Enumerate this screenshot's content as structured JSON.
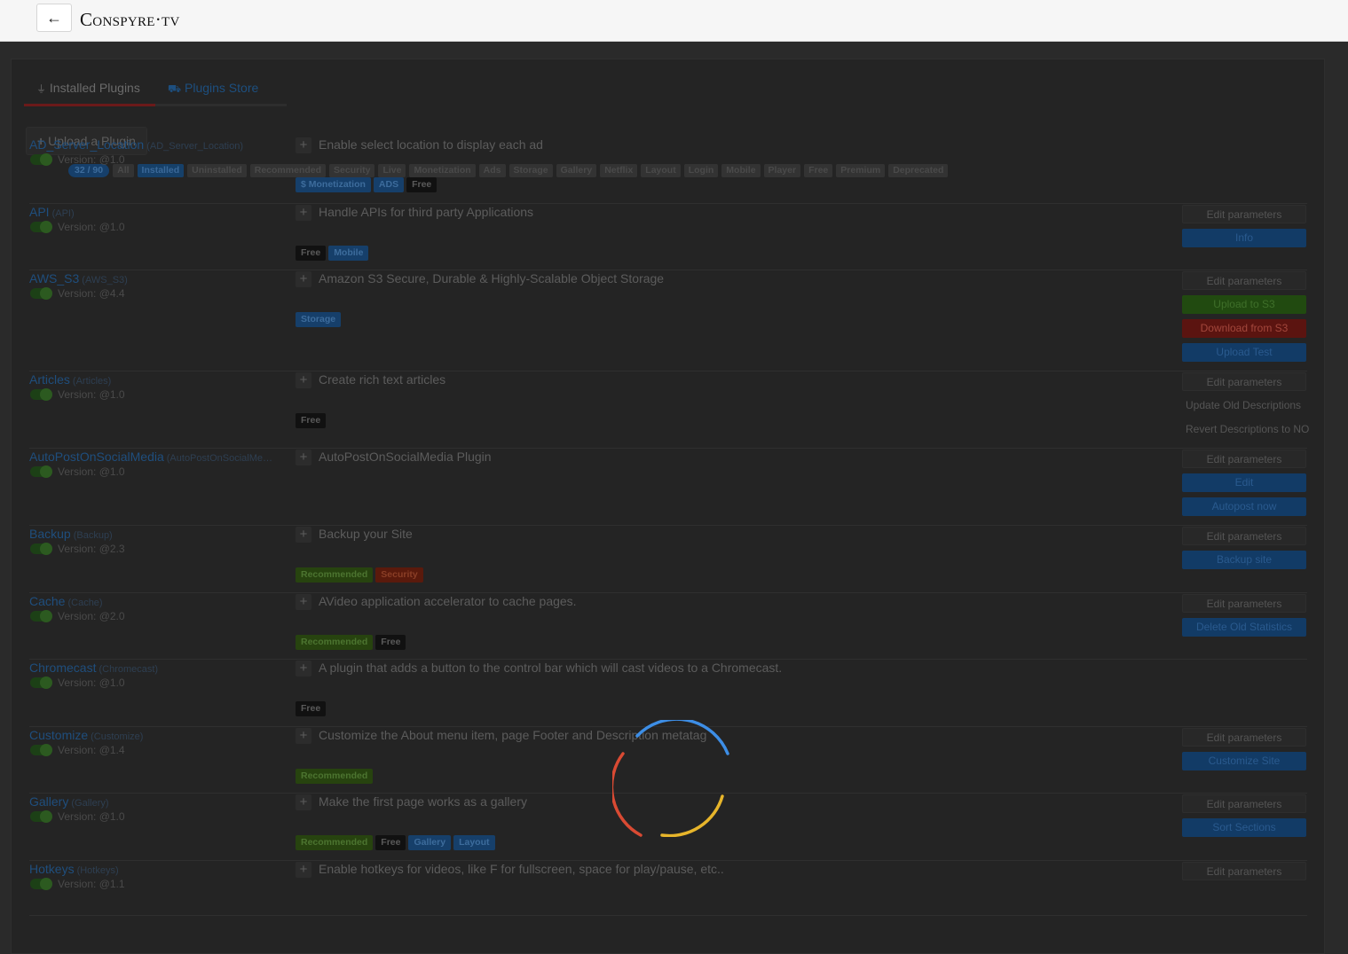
{
  "header": {
    "back_icon": "←",
    "logo": "Conspyre·tv"
  },
  "tabs": [
    {
      "icon": "plug-icon",
      "label": "Installed Plugins",
      "icon_glyph": "🔌"
    },
    {
      "icon": "cart-icon",
      "label": "Plugins Store",
      "icon_glyph": "🛒"
    }
  ],
  "upload_button": {
    "label": "Upload a Plugin",
    "icon_glyph": "+"
  },
  "filters": [
    "32 / 90",
    "All",
    "Installed",
    "Uninstalled",
    "Recommended",
    "Security",
    "Live",
    "Monetization",
    "Ads",
    "Storage",
    "Gallery",
    "Netflix",
    "Layout",
    "Login",
    "Mobile",
    "Player",
    "Free",
    "Premium",
    "Deprecated"
  ],
  "plugins": [
    {
      "name": "AD_Server_Location",
      "uuid": "(AD_Server_Location)",
      "version": "Version: @1.0",
      "description": "Enable select location to display each ad",
      "tags": [
        {
          "label": "$ Monetization",
          "color": "blue"
        },
        {
          "label": "ADS",
          "color": "blue"
        },
        {
          "label": "Free",
          "color": "dark"
        }
      ],
      "actions": []
    },
    {
      "name": "API",
      "uuid": "(API)",
      "version": "Version: @1.0",
      "description": "Handle APIs for third party Applications",
      "tags": [
        {
          "label": "Free",
          "color": "dark"
        },
        {
          "label": "Mobile",
          "color": "blue"
        }
      ],
      "actions": [
        {
          "label": "Edit parameters",
          "style": "edit"
        },
        {
          "label": "Info",
          "style": "blue"
        }
      ]
    },
    {
      "name": "AWS_S3",
      "uuid": "(AWS_S3)",
      "version": "Version: @4.4",
      "description": "Amazon S3 Secure, Durable & Highly-Scalable Object Storage",
      "tags": [
        {
          "label": "Storage",
          "color": "blue"
        }
      ],
      "actions": [
        {
          "label": "Edit parameters",
          "style": "edit"
        },
        {
          "label": "Upload to S3",
          "style": "green"
        },
        {
          "label": "Download from S3",
          "style": "red"
        },
        {
          "label": "Upload Test",
          "style": "blue"
        }
      ]
    },
    {
      "name": "Articles",
      "uuid": "(Articles)",
      "version": "Version: @1.0",
      "description": "Create rich text articles",
      "tags": [
        {
          "label": "Free",
          "color": "dark"
        }
      ],
      "actions": [
        {
          "label": "Edit parameters",
          "style": "edit"
        },
        {
          "label": "Update Old Descriptions",
          "style": "plain"
        },
        {
          "label": "Revert Descriptions to NO",
          "style": "plain"
        }
      ]
    },
    {
      "name": "AutoPostOnSocialMedia",
      "uuid": "(AutoPostOnSocialMe…",
      "version": "Version: @1.0",
      "description": "AutoPostOnSocialMedia Plugin",
      "tags": [],
      "actions": [
        {
          "label": "Edit parameters",
          "style": "edit"
        },
        {
          "label": "Edit",
          "style": "blue"
        },
        {
          "label": "Autopost now",
          "style": "blue"
        }
      ]
    },
    {
      "name": "Backup",
      "uuid": "(Backup)",
      "version": "Version: @2.3",
      "description": "Backup your Site",
      "tags": [
        {
          "label": "Recommended",
          "color": "green"
        },
        {
          "label": "Security",
          "color": "red"
        }
      ],
      "actions": [
        {
          "label": "Edit parameters",
          "style": "edit"
        },
        {
          "label": "Backup site",
          "style": "blue"
        }
      ]
    },
    {
      "name": "Cache",
      "uuid": "(Cache)",
      "version": "Version: @2.0",
      "description": "AVideo application accelerator to cache pages.",
      "tags": [
        {
          "label": "Recommended",
          "color": "green"
        },
        {
          "label": "Free",
          "color": "dark"
        }
      ],
      "actions": [
        {
          "label": "Edit parameters",
          "style": "edit"
        },
        {
          "label": "Delete Old Statistics",
          "style": "blue"
        }
      ]
    },
    {
      "name": "Chromecast",
      "uuid": "(Chromecast)",
      "version": "Version: @1.0",
      "description": "A plugin that adds a button to the control bar which will cast videos to a Chromecast.",
      "tags": [
        {
          "label": "Free",
          "color": "dark"
        }
      ],
      "actions": []
    },
    {
      "name": "Customize",
      "uuid": "(Customize)",
      "version": "Version: @1.4",
      "description": "Customize the About menu item, page Footer and Description metatag",
      "tags": [
        {
          "label": "Recommended",
          "color": "green"
        }
      ],
      "actions": [
        {
          "label": "Edit parameters",
          "style": "edit"
        },
        {
          "label": "Customize Site",
          "style": "blue"
        }
      ]
    },
    {
      "name": "Gallery",
      "uuid": "(Gallery)",
      "version": "Version: @1.0",
      "description": "Make the first page works as a gallery",
      "tags": [
        {
          "label": "Recommended",
          "color": "green"
        },
        {
          "label": "Free",
          "color": "dark"
        },
        {
          "label": "Gallery",
          "color": "blue"
        },
        {
          "label": "Layout",
          "color": "blue"
        }
      ],
      "actions": [
        {
          "label": "Edit parameters",
          "style": "edit"
        },
        {
          "label": "Sort Sections",
          "style": "blue"
        }
      ]
    },
    {
      "name": "Hotkeys",
      "uuid": "(Hotkeys)",
      "version": "Version: @1.1",
      "description": "Enable hotkeys for videos, like F for fullscreen, space for play/pause, etc..",
      "tags": [],
      "actions": [
        {
          "label": "Edit parameters",
          "style": "edit"
        }
      ]
    }
  ],
  "spinner": {
    "colors": [
      "#3d8ee6",
      "#d94a33",
      "#e7b52b"
    ]
  }
}
